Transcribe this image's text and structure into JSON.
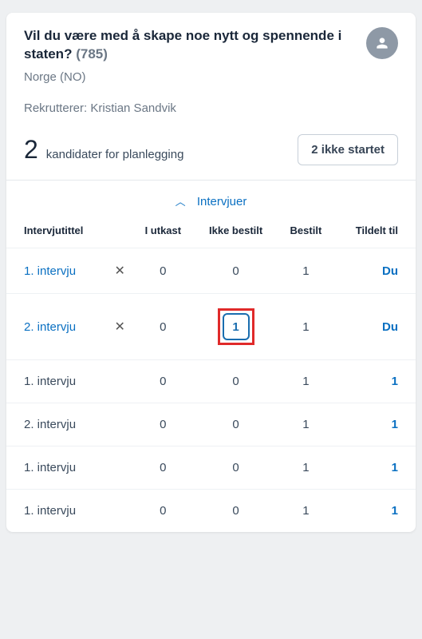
{
  "header": {
    "title": "Vil du være med å skape noe nytt og spennende i staten?",
    "id": "(785)",
    "location": "Norge (NO)",
    "recruiter_label": "Rekrutterer:",
    "recruiter_name": "Kristian Sandvik"
  },
  "summary": {
    "count": "2",
    "label": "kandidater for planlegging",
    "status_button": "2 ikke startet"
  },
  "collapse": {
    "label": "Intervjuer"
  },
  "columns": {
    "title": "Intervjutittel",
    "draft": "I utkast",
    "not_ordered": "Ikke bestilt",
    "ordered": "Bestilt",
    "assigned": "Tildelt til"
  },
  "rows": [
    {
      "title": "1. intervju",
      "closable": true,
      "link": true,
      "draft": "0",
      "not_ordered": "0",
      "ordered": "1",
      "assigned": "Du",
      "assigned_link": true,
      "highlight": false
    },
    {
      "title": "2. intervju",
      "closable": true,
      "link": true,
      "draft": "0",
      "not_ordered": "1",
      "ordered": "1",
      "assigned": "Du",
      "assigned_link": true,
      "highlight": true
    },
    {
      "title": "1. intervju",
      "closable": false,
      "link": false,
      "draft": "0",
      "not_ordered": "0",
      "ordered": "1",
      "assigned": "1",
      "assigned_link": true,
      "highlight": false
    },
    {
      "title": "2. intervju",
      "closable": false,
      "link": false,
      "draft": "0",
      "not_ordered": "0",
      "ordered": "1",
      "assigned": "1",
      "assigned_link": true,
      "highlight": false
    },
    {
      "title": "1. intervju",
      "closable": false,
      "link": false,
      "draft": "0",
      "not_ordered": "0",
      "ordered": "1",
      "assigned": "1",
      "assigned_link": true,
      "highlight": false
    },
    {
      "title": "1. intervju",
      "closable": false,
      "link": false,
      "draft": "0",
      "not_ordered": "0",
      "ordered": "1",
      "assigned": "1",
      "assigned_link": true,
      "highlight": false
    }
  ]
}
